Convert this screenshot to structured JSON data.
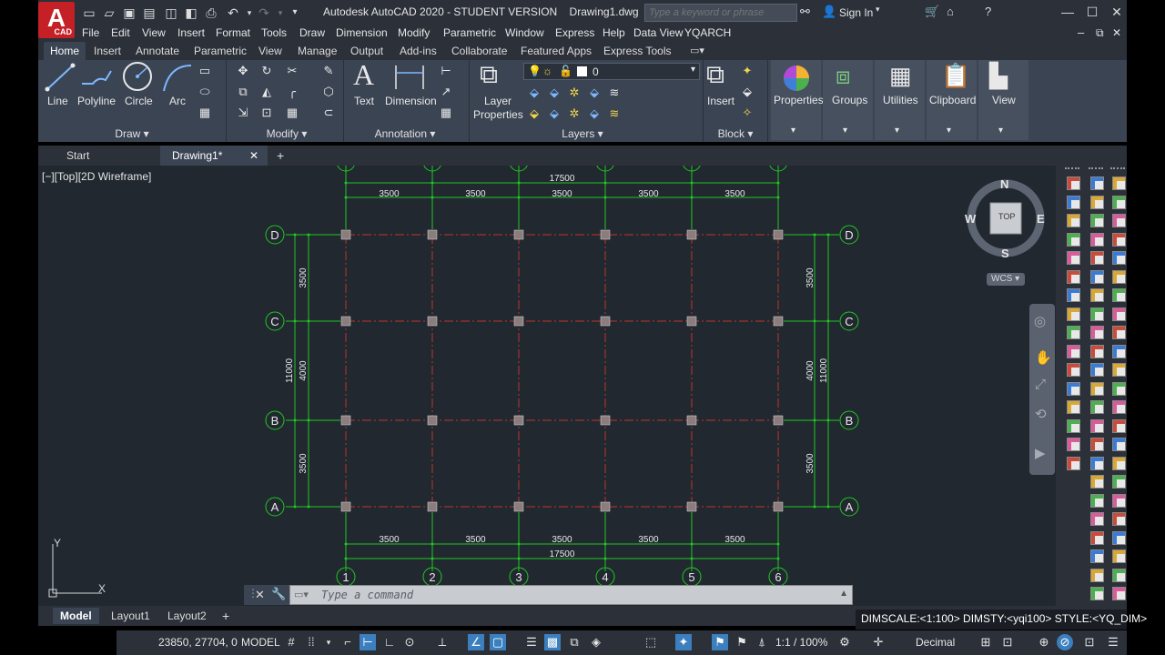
{
  "app": {
    "title": "Autodesk AutoCAD 2020 - STUDENT VERSION    Drawing1.dwg",
    "logo_letter": "A",
    "logo_sub": "CAD"
  },
  "search": {
    "placeholder": "Type a keyword or phrase"
  },
  "account": {
    "signin_label": "Sign In"
  },
  "menu": [
    "File",
    "Edit",
    "View",
    "Insert",
    "Format",
    "Tools",
    "Draw",
    "Dimension",
    "Modify",
    "Parametric",
    "Window",
    "Express",
    "Help",
    "Data View",
    "YQARCH"
  ],
  "ribbon_tabs": [
    "Home",
    "Insert",
    "Annotate",
    "Parametric",
    "View",
    "Manage",
    "Output",
    "Add-ins",
    "Collaborate",
    "Featured Apps",
    "Express Tools"
  ],
  "ribbon": {
    "draw": {
      "title": "Draw",
      "line": "Line",
      "polyline": "Polyline",
      "circle": "Circle",
      "arc": "Arc"
    },
    "modify": {
      "title": "Modify"
    },
    "annotation": {
      "title": "Annotation",
      "text": "Text",
      "dimension": "Dimension"
    },
    "layers": {
      "title": "Layers",
      "layer_properties_1": "Layer",
      "layer_properties_2": "Properties",
      "current_layer": "0"
    },
    "block": {
      "title": "Block",
      "insert": "Insert"
    },
    "properties": "Properties",
    "groups": "Groups",
    "utilities": "Utilities",
    "clipboard": "Clipboard",
    "view": "View"
  },
  "file_tabs": {
    "start": "Start",
    "drawing": "Drawing1*"
  },
  "viewport": {
    "label": "[−][Top][2D Wireframe]",
    "viewcube": {
      "n": "N",
      "s": "S",
      "e": "E",
      "w": "W",
      "face": "TOP"
    },
    "wcs": "WCS",
    "ucs_x": "X",
    "ucs_y": "Y"
  },
  "drawing": {
    "columns": [
      "1",
      "2",
      "3",
      "4",
      "5",
      "6"
    ],
    "rows": [
      "D",
      "C",
      "B",
      "A"
    ],
    "bay_dim": "3500",
    "total_x": "17500",
    "row_dims": [
      "3500",
      "4000",
      "3500"
    ],
    "total_y": "11000"
  },
  "command": {
    "placeholder": "Type a command"
  },
  "layout_tabs": [
    "Model",
    "Layout1",
    "Layout2"
  ],
  "dimscale": "DIMSCALE:<1:100> DIMSTY:<yqi100> STYLE:<YQ_DIM>",
  "status": {
    "coords": "23850, 27704, 0",
    "space": "MODEL",
    "scale": "1:1 / 100%",
    "units": "Decimal"
  },
  "colors": {
    "canvas": "#212830",
    "ribbon": "#3b4453",
    "grid_green": "#1fc81f",
    "axis_red": "#c0342e",
    "column_fill": "#8b7d7d"
  }
}
